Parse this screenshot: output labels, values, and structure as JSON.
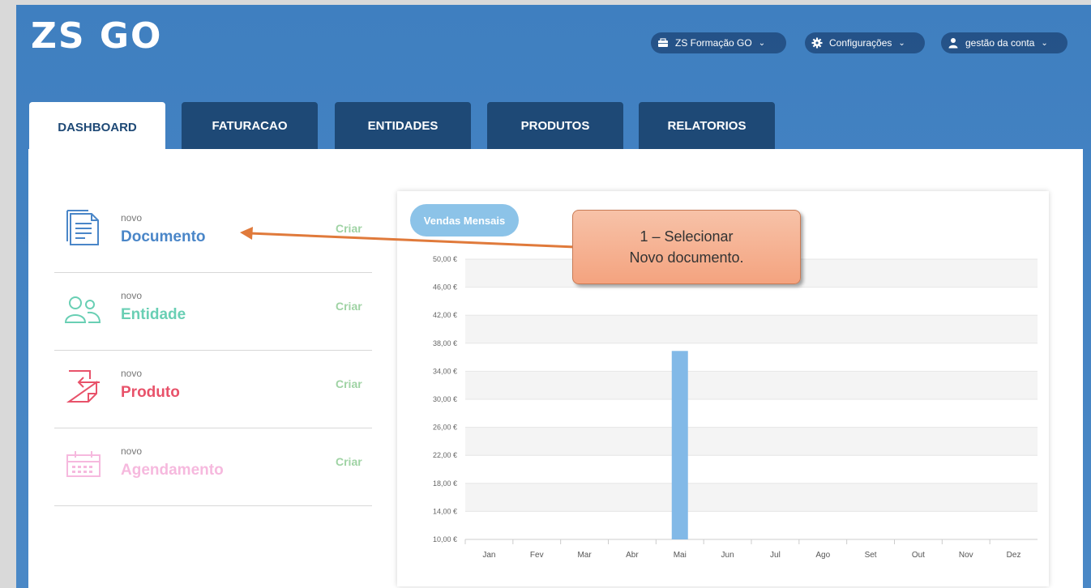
{
  "app": {
    "logo": "ZS GO",
    "accent": "#3f7fc0",
    "tab_active_color": "#1e4976"
  },
  "topbar": {
    "company": {
      "label": "ZS Formação GO",
      "icon": "building-icon"
    },
    "settings": {
      "label": "Configurações",
      "icon": "gear-icon"
    },
    "account": {
      "label": "gestão da conta",
      "icon": "user-icon"
    }
  },
  "tabs": [
    {
      "label": "DASHBOARD",
      "active": true
    },
    {
      "label": "FATURACAO",
      "active": false
    },
    {
      "label": "ENTIDADES",
      "active": false
    },
    {
      "label": "PRODUTOS",
      "active": false
    },
    {
      "label": "RELATORIOS",
      "active": false
    }
  ],
  "quick_create": [
    {
      "small": "novo",
      "title": "Documento",
      "action": "Criar",
      "icon": "document-icon",
      "color": "#4a86c8"
    },
    {
      "small": "novo",
      "title": "Entidade",
      "action": "Criar",
      "icon": "users-icon",
      "color": "#69cfb4"
    },
    {
      "small": "novo",
      "title": "Produto",
      "action": "Criar",
      "icon": "product-icon",
      "color": "#e8526a"
    },
    {
      "small": "novo",
      "title": "Agendamento",
      "action": "Criar",
      "icon": "calendar-icon",
      "color": "#f6b9de"
    }
  ],
  "chart_badge": "Vendas Mensais",
  "annotation": {
    "line1": "1 – Selecionar",
    "line2": "Novo documento."
  },
  "chart_data": {
    "type": "bar",
    "title": "Vendas Mensais",
    "categories": [
      "Jan",
      "Fev",
      "Mar",
      "Abr",
      "Mai",
      "Jun",
      "Jul",
      "Ago",
      "Set",
      "Out",
      "Nov",
      "Dez"
    ],
    "values": [
      0,
      0,
      0,
      0,
      36.9,
      0,
      0,
      0,
      0,
      0,
      0,
      0
    ],
    "y_ticks": [
      "50,00 €",
      "46,00 €",
      "42,00 €",
      "38,00 €",
      "34,00 €",
      "30,00 €",
      "26,00 €",
      "22,00 €",
      "18,00 €",
      "14,00 €",
      "10,00 €"
    ],
    "ylim": [
      10,
      50
    ],
    "grid": true,
    "bar_color": "#82b9e7"
  }
}
